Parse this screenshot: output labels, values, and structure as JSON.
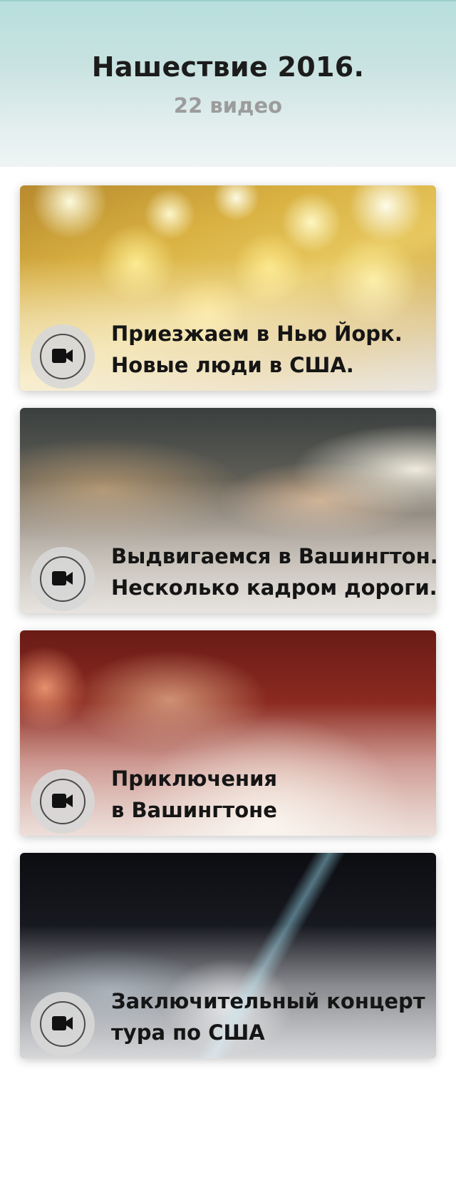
{
  "header": {
    "title": "Нашествие 2016.",
    "subtitle": "22 видео"
  },
  "videos": [
    {
      "title_line1": "Приезжаем в Нью Йорк.",
      "title_line2": "Новые люди в США.",
      "icon": "video-camera-icon"
    },
    {
      "title_line1": "Выдвигаемся в Вашингтон.",
      "title_line2": "Несколько кадром дороги.",
      "icon": "video-camera-icon"
    },
    {
      "title_line1": "Приключения",
      "title_line2": "в Вашингтоне",
      "icon": "video-camera-icon"
    },
    {
      "title_line1": "Заключительный концерт",
      "title_line2": "тура по США",
      "icon": "video-camera-icon"
    }
  ],
  "colors": {
    "header_bg": "#c9e3e1",
    "title_text": "#1c1c1c",
    "subtitle_text": "#9c9c9c"
  }
}
